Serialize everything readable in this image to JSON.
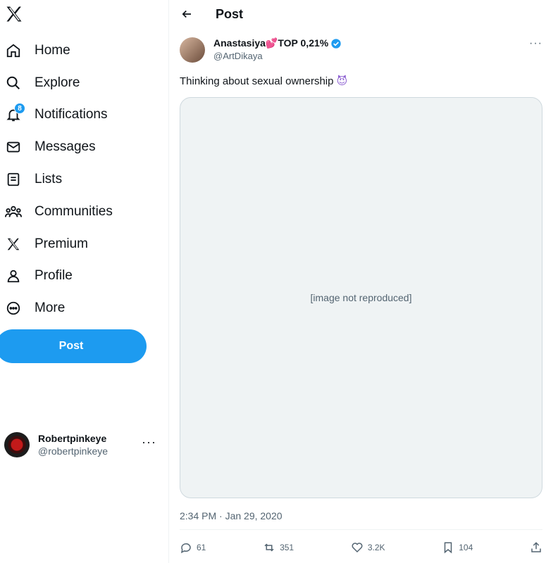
{
  "nav": {
    "items": [
      {
        "label": "Home",
        "icon": "home-icon"
      },
      {
        "label": "Explore",
        "icon": "search-icon"
      },
      {
        "label": "Notifications",
        "icon": "bell-icon",
        "badge": "8"
      },
      {
        "label": "Messages",
        "icon": "envelope-icon"
      },
      {
        "label": "Lists",
        "icon": "list-icon"
      },
      {
        "label": "Communities",
        "icon": "communities-icon"
      },
      {
        "label": "Premium",
        "icon": "x-logo-icon"
      },
      {
        "label": "Profile",
        "icon": "person-icon"
      },
      {
        "label": "More",
        "icon": "more-circle-icon"
      }
    ],
    "post_label": "Post"
  },
  "account": {
    "name": "Robertpinkeye",
    "handle": "@robertpinkeye"
  },
  "page": {
    "title": "Post"
  },
  "post": {
    "author_name": "Anastasiya💕TOP 0,21%",
    "author_handle": "@ArtDikaya",
    "text": "Thinking about sexual ownership",
    "emoji": "😈",
    "media_placeholder": "[image not reproduced]",
    "timestamp": "2:34 PM · Jan 29, 2020",
    "stats": {
      "replies": "61",
      "reposts": "351",
      "likes": "3.2K",
      "bookmarks": "104"
    }
  },
  "colors": {
    "accent": "#1d9bf0",
    "text": "#0f1419",
    "muted": "#536471"
  }
}
